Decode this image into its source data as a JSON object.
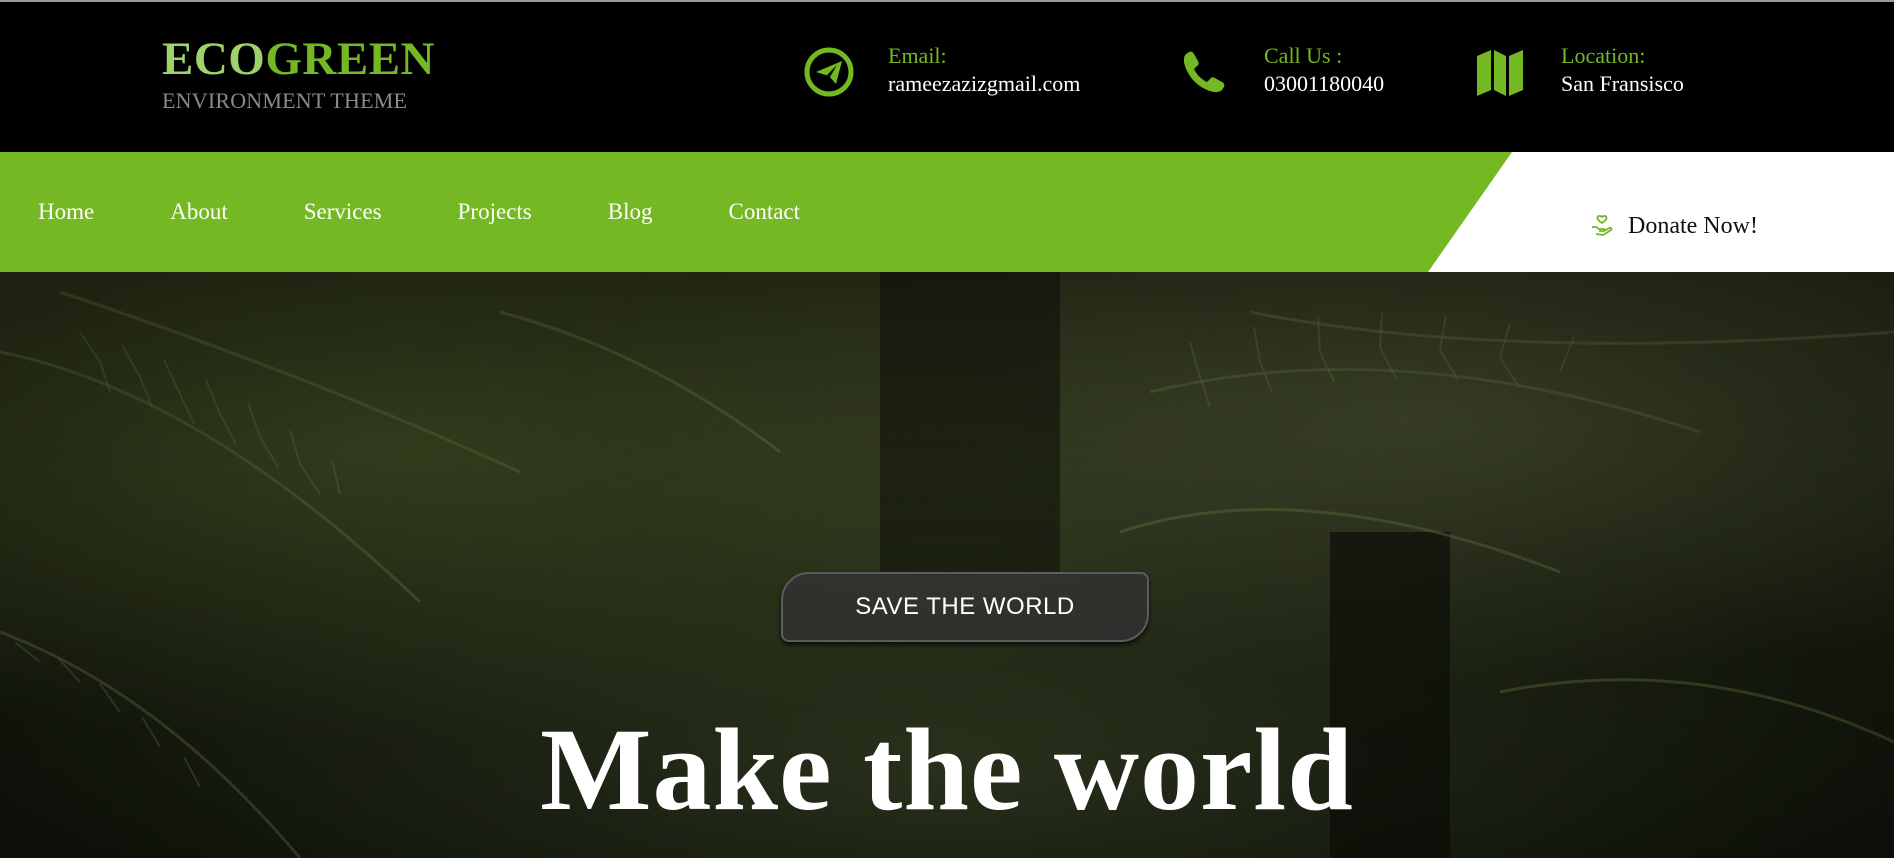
{
  "colors": {
    "accent": "#74b823",
    "accent_light": "#9ed36a",
    "header_bg": "#000000",
    "nav_bg": "#74b823"
  },
  "logo": {
    "part1": "ECO",
    "part2": "GREEN",
    "subtitle": "ENVIRONMENT THEME"
  },
  "contacts": [
    {
      "icon": "paper-plane-icon",
      "label": "Email:",
      "value": "rameezazizgmail.com"
    },
    {
      "icon": "phone-icon",
      "label": "Call Us :",
      "value": "03001180040"
    },
    {
      "icon": "map-icon",
      "label": "Location:",
      "value": "San Fransisco"
    }
  ],
  "nav": {
    "items": [
      {
        "label": "Home"
      },
      {
        "label": "About"
      },
      {
        "label": "Services"
      },
      {
        "label": "Projects"
      },
      {
        "label": "Blog"
      },
      {
        "label": "Contact"
      }
    ],
    "donate": {
      "icon": "donate-hand-icon",
      "label": "Donate Now!"
    }
  },
  "hero": {
    "badge": "SAVE THE WORLD",
    "headline": "Make the world"
  }
}
